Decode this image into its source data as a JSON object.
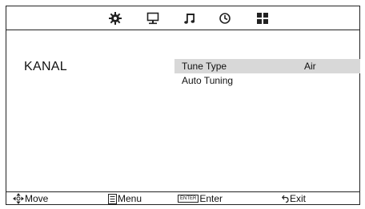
{
  "top_bar": {
    "tabs": [
      {
        "icon": "gear-icon",
        "active": false
      },
      {
        "icon": "monitor-icon",
        "active": false
      },
      {
        "icon": "music-note-icon",
        "active": false
      },
      {
        "icon": "clock-icon",
        "active": false
      },
      {
        "icon": "grid-icon",
        "active": false
      }
    ]
  },
  "main": {
    "section_title": "KANAL",
    "settings": [
      {
        "label": "Tune Type",
        "value": "Air",
        "selected": true
      },
      {
        "label": "Auto Tuning",
        "value": "",
        "selected": false
      }
    ]
  },
  "footer": {
    "move": {
      "icon": "move-arrows-icon",
      "label": "Move"
    },
    "menu": {
      "icon": "menu-icon",
      "label": "Menu"
    },
    "enter": {
      "key": "ENTER",
      "label": "Enter"
    },
    "exit": {
      "icon": "return-arrow-icon",
      "label": "Exit"
    }
  },
  "colors": {
    "selected_row": "#d8d8d8",
    "border": "#222222",
    "background": "#ffffff"
  }
}
